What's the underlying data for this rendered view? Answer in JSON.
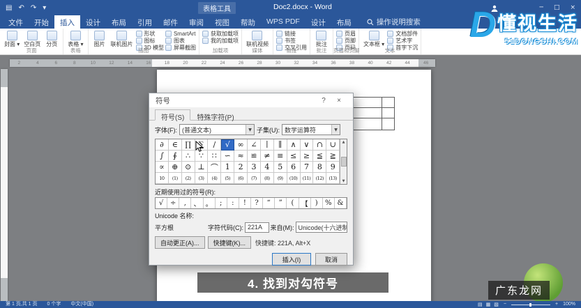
{
  "title_bar": {
    "quick_access": [
      {
        "name": "save",
        "glyph": "▤"
      },
      {
        "name": "undo",
        "glyph": "↶"
      },
      {
        "name": "redo",
        "glyph": "↷"
      },
      {
        "name": "customize-quick-access",
        "glyph": "▾"
      }
    ],
    "context_tool_label": "表格工具",
    "document_title": "Doc2.docx - Word",
    "window_controls": [
      {
        "name": "minimize",
        "glyph": "─"
      },
      {
        "name": "maximize",
        "glyph": "□"
      },
      {
        "name": "close",
        "glyph": "×"
      }
    ]
  },
  "ribbon": {
    "tabs": [
      {
        "label": "文件"
      },
      {
        "label": "开始"
      },
      {
        "label": "插入",
        "active": true
      },
      {
        "label": "设计"
      },
      {
        "label": "布局"
      },
      {
        "label": "引用"
      },
      {
        "label": "邮件"
      },
      {
        "label": "审阅"
      },
      {
        "label": "视图"
      },
      {
        "label": "帮助"
      },
      {
        "label": "WPS PDF"
      },
      {
        "label": "设计"
      },
      {
        "label": "布局"
      }
    ],
    "search_label": "操作说明搜索",
    "groups": [
      {
        "label": "页面",
        "columns": [
          {
            "type": "tall",
            "label": "封面",
            "arrow": true
          },
          {
            "type": "tall",
            "label": "空白页"
          },
          {
            "type": "tall",
            "label": "分页"
          }
        ]
      },
      {
        "label": "表格",
        "columns": [
          {
            "type": "tall",
            "label": "表格",
            "arrow": true
          }
        ]
      },
      {
        "label": "插图",
        "columns": [
          {
            "type": "tall",
            "label": "图片"
          },
          {
            "type": "tall",
            "label": "联机图片"
          },
          {
            "type": "stack",
            "items": [
              "形状",
              "图标",
              "3D 模型"
            ]
          },
          {
            "type": "stack",
            "items": [
              "SmartArt",
              "图表",
              "屏幕截图"
            ]
          }
        ]
      },
      {
        "label": "加载项",
        "columns": [
          {
            "type": "stack",
            "items": [
              "获取加载项",
              "我的加载项"
            ]
          }
        ]
      },
      {
        "label": "媒体",
        "columns": [
          {
            "type": "tall",
            "label": "联机视频"
          }
        ]
      },
      {
        "label": "链接",
        "columns": [
          {
            "type": "stack",
            "items": [
              "链接",
              "书签",
              "交叉引用"
            ]
          }
        ]
      },
      {
        "label": "批注",
        "columns": [
          {
            "type": "tall",
            "label": "批注"
          }
        ]
      },
      {
        "label": "页眉和页脚",
        "columns": [
          {
            "type": "stack",
            "items": [
              "页眉",
              "页脚",
              "页码"
            ]
          }
        ]
      },
      {
        "label": "文本",
        "columns": [
          {
            "type": "tall",
            "label": "文本框",
            "arrow": true
          },
          {
            "type": "stack",
            "items": [
              "文档部件",
              "艺术字",
              "首字下沉"
            ]
          }
        ]
      }
    ]
  },
  "ruler": {
    "numbers": [
      2,
      4,
      6,
      8,
      10,
      12,
      14,
      16,
      18,
      20,
      22,
      24,
      26,
      28,
      30,
      32,
      34,
      36,
      38,
      40,
      42,
      44,
      46
    ]
  },
  "dialog": {
    "title": "符号",
    "help_icon": "?",
    "close_icon": "×",
    "dropdown_arrow": "▼",
    "scroll_up": "▲",
    "scroll_down": "▼",
    "tabs": [
      {
        "label": "符号(S)",
        "active": true
      },
      {
        "label": "特殊字符(P)"
      }
    ],
    "font_label": "字体(F):",
    "font_value": "(普通文本)",
    "subset_label": "子集(U):",
    "subset_value": "数学运算符",
    "symbol_grid": {
      "selected_row": 0,
      "selected_col": 5,
      "rows": [
        [
          "∂",
          "∈",
          "∏",
          "∑",
          "∕",
          "√",
          "∞",
          "∠",
          "∣",
          "∥",
          "∧",
          "∨",
          "∩",
          "∪"
        ],
        [
          "∫",
          "∮",
          "∴",
          "∵",
          "∷",
          "∽",
          "≈",
          "≌",
          "≠",
          "≡",
          "≤",
          "≥",
          "≦",
          "≧"
        ],
        [
          "∝",
          "⊕",
          "⊙",
          "⊥",
          "⌒",
          "1",
          "2",
          "3",
          "4",
          "5",
          "6",
          "7",
          "8",
          "9"
        ],
        [
          "10",
          "(1)",
          "(2)",
          "(3)",
          "(4)",
          "(5)",
          "(6)",
          "(7)",
          "(8)",
          "(9)",
          "(10)",
          "(11)",
          "(12)",
          "(13)"
        ]
      ]
    },
    "recent_label": "近期使用过的符号(R):",
    "recent_symbols": [
      "√",
      "÷",
      ",",
      "、",
      "。",
      ";",
      ":",
      "!",
      "?",
      "“",
      "”",
      "(",
      "【",
      ")",
      "%",
      "&"
    ],
    "unicode_name_label": "Unicode 名称:",
    "unicode_name_value": "平方根",
    "char_code_label": "字符代码(C):",
    "char_code_value": "221A",
    "from_label": "来自(M):",
    "from_value": "Unicode(十六进制)",
    "autocorrect_button": "自动更正(A)...",
    "shortcut_button": "快捷键(K)...",
    "shortcut_text": "快捷键: 221A, Alt+X",
    "insert_button": "插入(I)",
    "cancel_button": "取消"
  },
  "caption": {
    "text": "4. 找到对勾符号"
  },
  "watermark_top": {
    "logo_letter": "D",
    "brand": "懂视生活",
    "url": "51DONGSHI.COM"
  },
  "watermark_bottom": {
    "text": "广东龙网"
  },
  "status_bar": {
    "left": [
      "第 1 页,共 1 页",
      "0 个字",
      "中文(中国)"
    ],
    "view_icons": [
      {
        "name": "read-mode",
        "glyph": "▤"
      },
      {
        "name": "print-layout",
        "glyph": "▦"
      },
      {
        "name": "web-layout",
        "glyph": "▧"
      }
    ],
    "zoom_out": "−",
    "zoom_in": "+",
    "zoom_level": "100%"
  }
}
